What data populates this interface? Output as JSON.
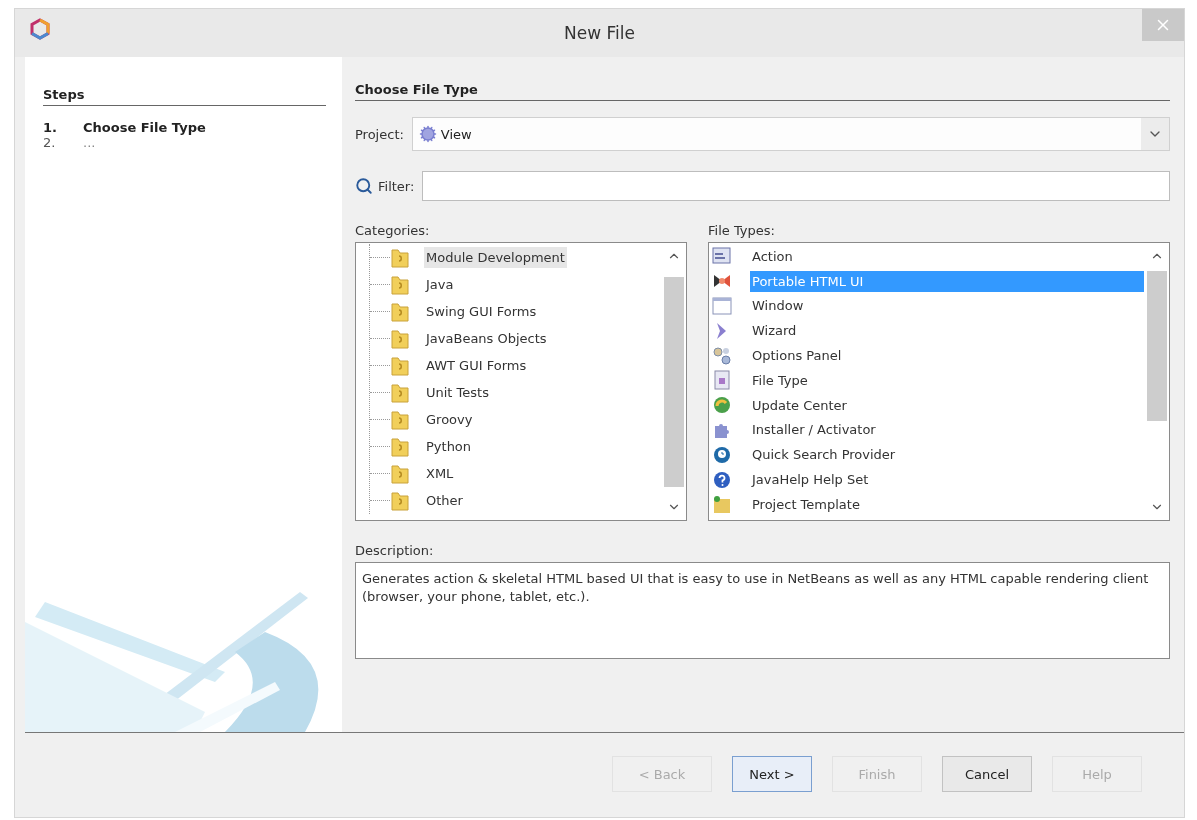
{
  "window": {
    "title": "New File"
  },
  "steps": {
    "heading": "Steps",
    "items": [
      {
        "number": "1.",
        "label": "Choose File Type",
        "selected": true
      },
      {
        "number": "2.",
        "label": "...",
        "selected": false
      }
    ]
  },
  "panel": {
    "heading": "Choose File Type",
    "project": {
      "label": "Project:",
      "value": "View"
    },
    "filter": {
      "label": "Filter:"
    }
  },
  "categories": {
    "label": "Categories:",
    "items": [
      {
        "label": "Module Development",
        "selected": true
      },
      {
        "label": "Java",
        "selected": false
      },
      {
        "label": "Swing GUI Forms",
        "selected": false
      },
      {
        "label": "JavaBeans Objects",
        "selected": false
      },
      {
        "label": "AWT GUI Forms",
        "selected": false
      },
      {
        "label": "Unit Tests",
        "selected": false
      },
      {
        "label": "Groovy",
        "selected": false
      },
      {
        "label": "Python",
        "selected": false
      },
      {
        "label": "XML",
        "selected": false
      },
      {
        "label": "Other",
        "selected": false
      }
    ]
  },
  "file_types": {
    "label": "File Types:",
    "items": [
      {
        "label": "Action",
        "kind": "action",
        "selected": false
      },
      {
        "label": "Portable HTML UI",
        "kind": "html",
        "selected": true
      },
      {
        "label": "Window",
        "kind": "window",
        "selected": false
      },
      {
        "label": "Wizard",
        "kind": "wizard",
        "selected": false
      },
      {
        "label": "Options Panel",
        "kind": "options",
        "selected": false
      },
      {
        "label": "File Type",
        "kind": "filetype",
        "selected": false
      },
      {
        "label": "Update Center",
        "kind": "update",
        "selected": false
      },
      {
        "label": "Installer / Activator",
        "kind": "installer",
        "selected": false
      },
      {
        "label": "Quick Search Provider",
        "kind": "search",
        "selected": false
      },
      {
        "label": "JavaHelp Help Set",
        "kind": "help",
        "selected": false
      },
      {
        "label": "Project Template",
        "kind": "template",
        "selected": false
      }
    ]
  },
  "description": {
    "label": "Description:",
    "text": "Generates action & skeletal HTML based UI that is easy to use in NetBeans as well as any HTML capable rendering client (browser, your phone, tablet, etc.)."
  },
  "buttons": [
    {
      "label": "< Back",
      "disabled": true,
      "default": false
    },
    {
      "label": "Next >",
      "disabled": false,
      "default": true
    },
    {
      "label": "Finish",
      "disabled": true,
      "default": false
    },
    {
      "label": "Cancel",
      "disabled": false,
      "default": false
    },
    {
      "label": "Help",
      "disabled": true,
      "default": false
    }
  ]
}
